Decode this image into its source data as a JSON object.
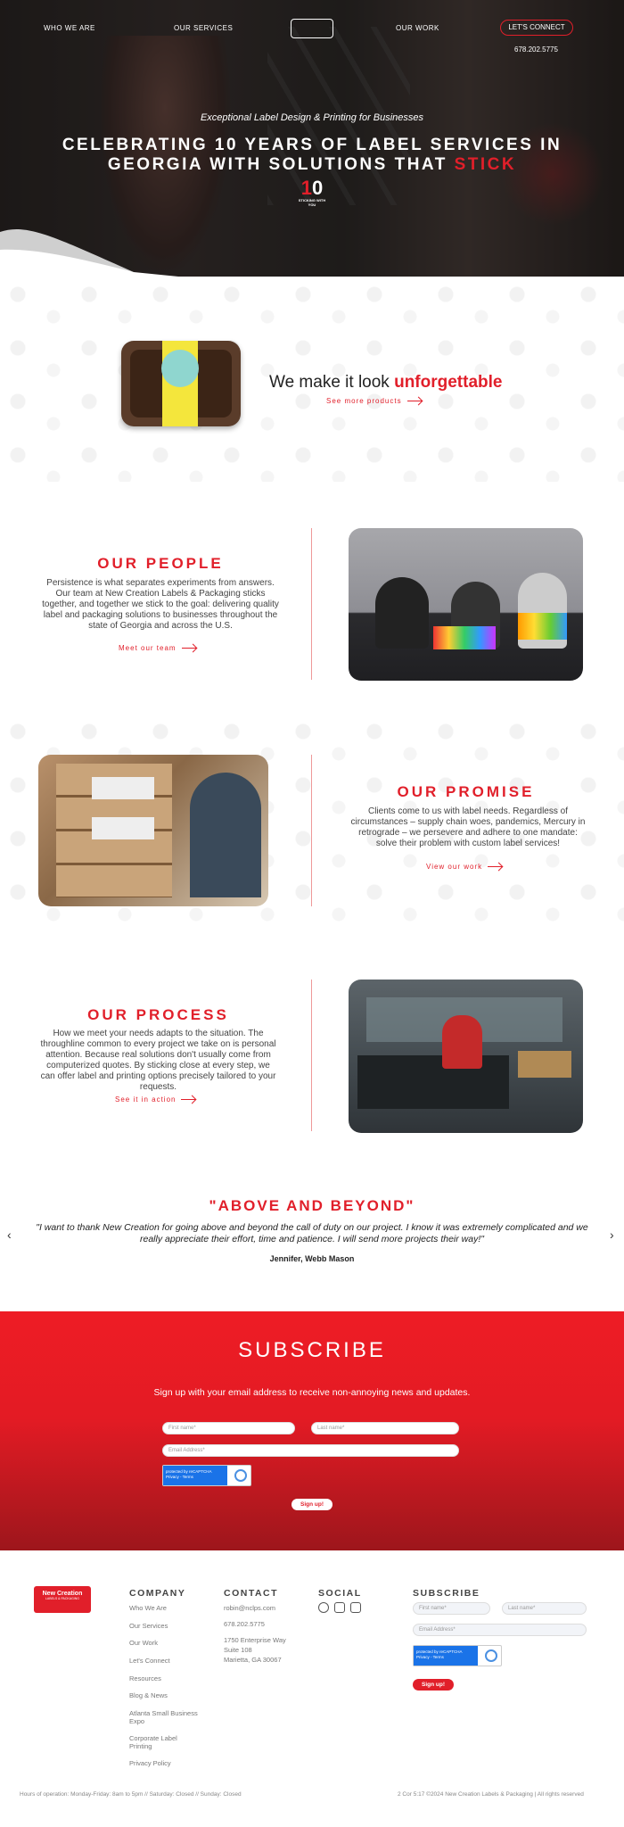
{
  "nav": {
    "who_we_are": "WHO WE ARE",
    "our_services": "OUR SERVICES",
    "our_work": "OUR WORK",
    "lets_connect": "LET'S CONNECT",
    "phone": "678.202.5775"
  },
  "hero": {
    "tagline": "Exceptional Label Design & Printing for Businesses",
    "headline": "CELEBRATING 10 YEARS OF LABEL SERVICES IN GEORGIA WITH SOLUTIONS THAT",
    "headline_accent": "STICK",
    "badge_number_1": "1",
    "badge_number_0": "0",
    "badge_text": "STICKING WITH YOU"
  },
  "products": {
    "headline_lead": "We make it look",
    "headline_accent": "unforgettable",
    "link": "See more products"
  },
  "people": {
    "title": "OUR PEOPLE",
    "text": "Persistence is what separates experiments from answers. Our team at New Creation Labels & Packaging sticks together, and together we stick to the goal: delivering quality label and packaging solutions to businesses throughout the state of Georgia and across the U.S.",
    "link": "Meet our team"
  },
  "promise": {
    "title": "OUR PROMISE",
    "text": "Clients come to us with label needs. Regardless of circumstances – supply chain woes, pandemics, Mercury in retrograde – we persevere and adhere to one mandate: solve their problem with custom label services!",
    "link": "View our work"
  },
  "process": {
    "title": "OUR PROCESS",
    "text": "How we meet your needs adapts to the situation. The throughline common to every project we take on is personal attention. Because real solutions don't usually come from computerized quotes. By sticking close at every step, we can offer label and printing options precisely tailored to your requests.",
    "link": "See it in action"
  },
  "testimonial": {
    "title": "\"ABOVE AND BEYOND\"",
    "quote": "\"I want to thank New Creation for going above and beyond the call of duty on our project. I know it was extremely complicated and we really appreciate their effort, time and patience. I will send more projects their way!\"",
    "author": "Jennifer, Webb Mason",
    "prev": "‹",
    "next": "›"
  },
  "subscribe": {
    "title": "SUBSCRIBE",
    "text": "Sign up with your email address to receive non-annoying news and updates.",
    "first_name": "First name*",
    "last_name": "Last name*",
    "email": "Email Address*",
    "recaptcha": "protected by reCAPTCHA",
    "recaptcha_links": "Privacy - Terms",
    "button": "Sign up!"
  },
  "footer": {
    "logo_main": "New Creation",
    "logo_sub": "LABELS & PACKAGING",
    "company_heading": "COMPANY",
    "company_links": [
      "Who We Are",
      "Our Services",
      "Our Work",
      "Let's Connect",
      "Resources",
      "Blog & News",
      "Atlanta Small Business Expo",
      "Corporate Label Printing",
      "Privacy Policy"
    ],
    "contact_heading": "CONTACT",
    "email": "robin@nclps.com",
    "phone": "678.202.5775",
    "address_1": "1750 Enterprise Way",
    "address_2": "Suite 108",
    "address_3": "Marietta, GA 30067",
    "social_heading": "SOCIAL",
    "subscribe_heading": "SUBSCRIBE",
    "first_name": "First name*",
    "last_name": "Last name*",
    "email_field": "Email Address*",
    "recaptcha": "protected by reCAPTCHA",
    "recaptcha_links": "Privacy - Terms",
    "button": "Sign up!",
    "hours": "Hours of operation: Monday-Friday: 8am to 5pm // Saturday: Closed // Sunday: Closed",
    "copyright": "2 Cor 5:17 ©2024 New Creation Labels & Packaging | All rights reserved"
  },
  "colors": {
    "accent": "#e11f2a",
    "dark": "#222222"
  }
}
